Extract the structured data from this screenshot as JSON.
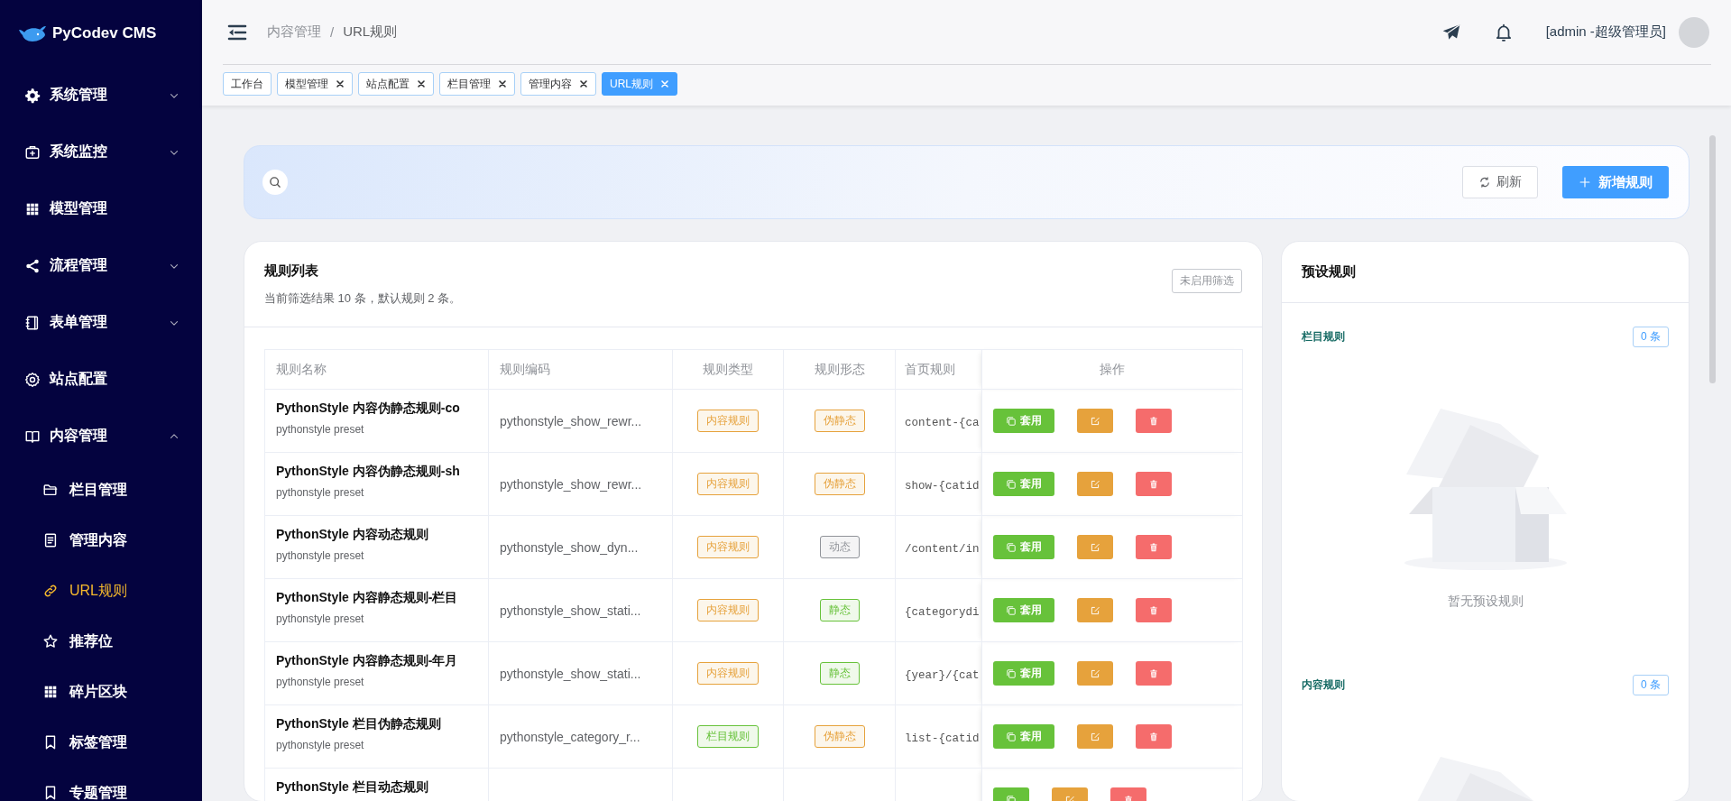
{
  "sidebar": {
    "logo": "PyCodev CMS",
    "items": [
      {
        "kind": "group",
        "label": "系统管理",
        "expanded": false
      },
      {
        "kind": "group",
        "label": "系统监控",
        "expanded": false
      },
      {
        "kind": "link",
        "label": "模型管理"
      },
      {
        "kind": "group",
        "label": "流程管理",
        "expanded": false
      },
      {
        "kind": "group",
        "label": "表单管理",
        "expanded": false
      },
      {
        "kind": "link",
        "label": "站点配置"
      },
      {
        "kind": "group",
        "label": "内容管理",
        "expanded": true,
        "children": [
          {
            "label": "栏目管理",
            "selected": false
          },
          {
            "label": "管理内容",
            "selected": false
          },
          {
            "label": "URL规则",
            "selected": true
          },
          {
            "label": "推荐位",
            "selected": false
          },
          {
            "label": "碎片区块",
            "selected": false
          },
          {
            "label": "标签管理",
            "selected": false
          },
          {
            "label": "专题管理",
            "selected": false
          }
        ]
      }
    ]
  },
  "header": {
    "breadcrumb": [
      "内容管理",
      "URL规则"
    ],
    "separator": "/",
    "user": "[admin -超级管理员]"
  },
  "tabs": [
    {
      "label": "工作台",
      "closable": false,
      "selected": false
    },
    {
      "label": "模型管理",
      "closable": true,
      "selected": false
    },
    {
      "label": "站点配置",
      "closable": true,
      "selected": false
    },
    {
      "label": "栏目管理",
      "closable": true,
      "selected": false
    },
    {
      "label": "管理内容",
      "closable": true,
      "selected": false
    },
    {
      "label": "URL规则",
      "closable": true,
      "selected": true
    }
  ],
  "toolbar": {
    "refresh": "刷新",
    "add": "新增规则"
  },
  "rules": {
    "title": "规则列表",
    "summary": "当前筛选结果 10 条，默认规则 2 条。",
    "filter": "未启用筛选",
    "columns": [
      "规则名称",
      "规则编码",
      "规则类型",
      "规则形态",
      "首页规则",
      "操作"
    ],
    "rows": [
      {
        "name": "PythonStyle 内容伪静态规则-co",
        "note": "pythonstyle preset",
        "code": "pythonstyle_show_rewr...",
        "type": {
          "text": "内容规则",
          "color": "#e6a23c"
        },
        "form": {
          "text": "伪静态",
          "color": "#e6a23c"
        },
        "home": "content-{ca",
        "apply": "套用"
      },
      {
        "name": "PythonStyle 内容伪静态规则-sh",
        "note": "pythonstyle preset",
        "code": "pythonstyle_show_rewr...",
        "type": {
          "text": "内容规则",
          "color": "#e6a23c"
        },
        "form": {
          "text": "伪静态",
          "color": "#e6a23c"
        },
        "home": "show-{catid",
        "apply": "套用"
      },
      {
        "name": "PythonStyle 内容动态规则",
        "note": "pythonstyle preset",
        "code": "pythonstyle_show_dyn...",
        "type": {
          "text": "内容规则",
          "color": "#e6a23c"
        },
        "form": {
          "text": "动态",
          "color": "#909399"
        },
        "home": "/content/in",
        "apply": "套用"
      },
      {
        "name": "PythonStyle 内容静态规则-栏目",
        "note": "pythonstyle preset",
        "code": "pythonstyle_show_stati...",
        "type": {
          "text": "内容规则",
          "color": "#e6a23c"
        },
        "form": {
          "text": "静态",
          "color": "#67c23a"
        },
        "home": "{categorydi",
        "apply": "套用"
      },
      {
        "name": "PythonStyle 内容静态规则-年月",
        "note": "pythonstyle preset",
        "code": "pythonstyle_show_stati...",
        "type": {
          "text": "内容规则",
          "color": "#e6a23c"
        },
        "form": {
          "text": "静态",
          "color": "#67c23a"
        },
        "home": "{year}/{cat",
        "apply": "套用"
      },
      {
        "name": "PythonStyle 栏目伪静态规则",
        "note": "pythonstyle preset",
        "code": "pythonstyle_category_r...",
        "type": {
          "text": "栏目规则",
          "color": "#67c23a"
        },
        "form": {
          "text": "伪静态",
          "color": "#e6a23c"
        },
        "home": "list-{catid",
        "apply": "套用"
      },
      {
        "name": "PythonStyle 栏目动态规则"
      }
    ]
  },
  "presets": {
    "title": "预设规则",
    "groups": [
      {
        "title": "栏目规则",
        "count": "0 条",
        "empty": "暂无预设规则"
      },
      {
        "title": "内容规则",
        "count": "0 条"
      }
    ]
  }
}
